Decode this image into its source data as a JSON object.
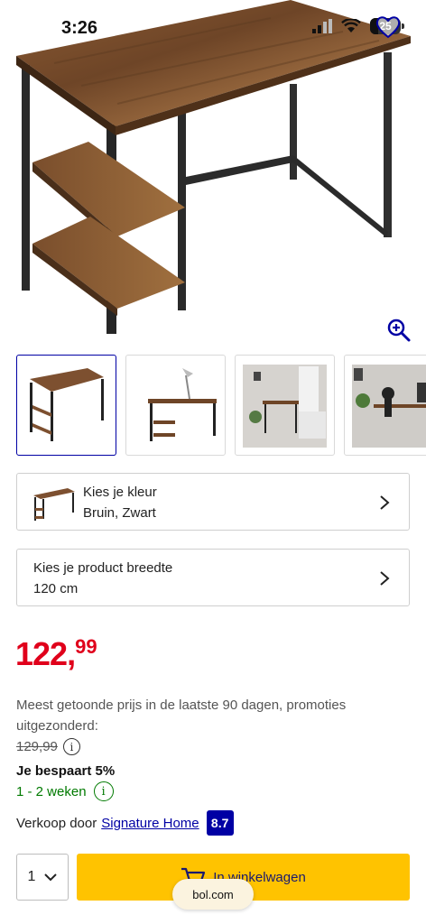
{
  "status": {
    "time": "3:26",
    "battery": "25",
    "battery_level": 0.25
  },
  "product_images": {
    "count_thumbs": 4
  },
  "variants": [
    {
      "title": "Kies je kleur",
      "value": "Bruin, Zwart"
    },
    {
      "title": "Kies je product breedte",
      "value": "120 cm"
    }
  ],
  "price": {
    "integer": "122,",
    "decimals": "99"
  },
  "promo_text": "Meest getoonde prijs in de laatste 90 dagen, promoties uitgezonderd:",
  "old_price": "129,99",
  "saving": "Je bespaart 5%",
  "delivery": "1 - 2 weken",
  "seller": {
    "prefix": "Verkoop door",
    "name": "Signature Home",
    "score": "8.7"
  },
  "quantity": "1",
  "cart_button": "In winkelwagen",
  "browser_url": "bol.com",
  "colors": {
    "price": "#e0001b",
    "brand_blue": "#0000a4",
    "cart_yellow": "#ffc300",
    "delivery_green": "#007a00"
  },
  "icons": [
    "signal-icon",
    "wifi-icon",
    "battery-icon",
    "heart-icon",
    "zoom-icon",
    "chevron-right-icon",
    "info-icon",
    "chevron-down-icon",
    "cart-icon"
  ]
}
